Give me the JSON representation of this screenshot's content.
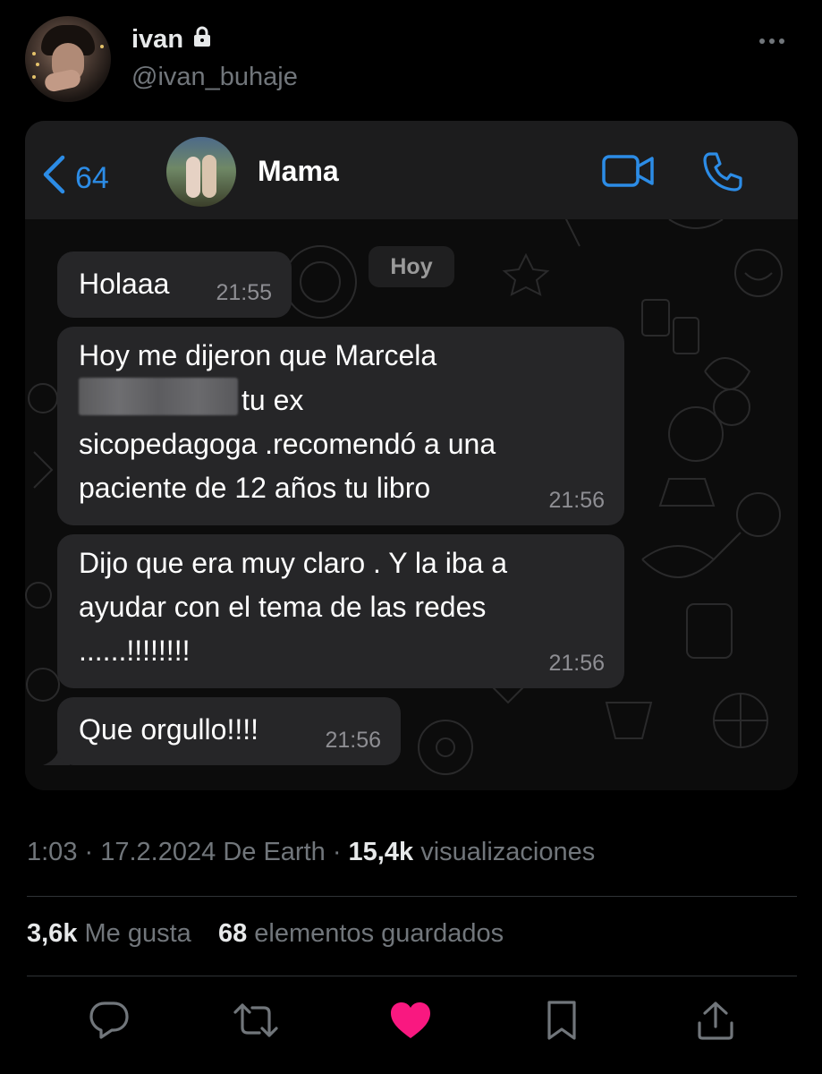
{
  "tweet": {
    "author_name": "ivan",
    "author_handle": "@ivan_buhaje",
    "time": "1:03",
    "date": "17.2.2024",
    "source": "De Earth",
    "views_count": "15,4k",
    "views_label": "visualizaciones",
    "likes_count": "3,6k",
    "likes_label": "Me gusta",
    "bookmarks_count": "68",
    "bookmarks_label": "elementos guardados"
  },
  "chat": {
    "back_count": "64",
    "contact_name": "Mama",
    "date_label": "Hoy",
    "messages": [
      {
        "lines": [
          "Holaaa"
        ],
        "time": "21:55"
      },
      {
        "line1": "Hoy me dijeron que Marcela",
        "line2": "tu ex",
        "line3": "sicopedagoga .recomendó a una",
        "line4": "paciente de 12 años tu libro",
        "time": "21:56"
      },
      {
        "line1": "Dijo que era muy claro . Y la iba a",
        "line2": "ayudar con el tema de las redes",
        "line3": "......!!!!!!!!",
        "time": "21:56"
      },
      {
        "lines": [
          "Que orgullo!!!!"
        ],
        "time": "21:56"
      }
    ]
  },
  "colors": {
    "background": "#000000",
    "whatsapp_accent": "#2c8ce6",
    "like_active": "#f91880",
    "muted_text": "#71767b"
  },
  "icons": {
    "lock": "lock-icon",
    "more": "more-icon",
    "back": "chevron-left-icon",
    "video": "video-camera-icon",
    "call": "phone-icon",
    "reply": "reply-icon",
    "retweet": "retweet-icon",
    "like": "heart-icon",
    "bookmark": "bookmark-icon",
    "share": "share-icon"
  }
}
